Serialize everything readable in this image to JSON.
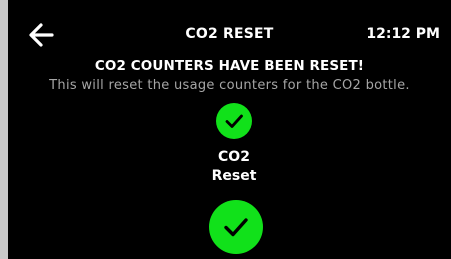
{
  "header": {
    "back_icon": "arrow-left-icon",
    "title": "CO2 RESET",
    "time": "12:12 PM"
  },
  "message": {
    "headline": "CO2 COUNTERS HAVE BEEN RESET!",
    "description": "This will reset the usage counters for the CO2 bottle."
  },
  "status": {
    "icon": "check-circle-icon",
    "label_line1": "CO2",
    "label_line2": "Reset"
  },
  "confirm": {
    "icon": "check-circle-icon"
  },
  "colors": {
    "background": "#000000",
    "accent_green": "#11e11a",
    "text_primary": "#ffffff",
    "text_secondary": "#a6a6a6"
  }
}
